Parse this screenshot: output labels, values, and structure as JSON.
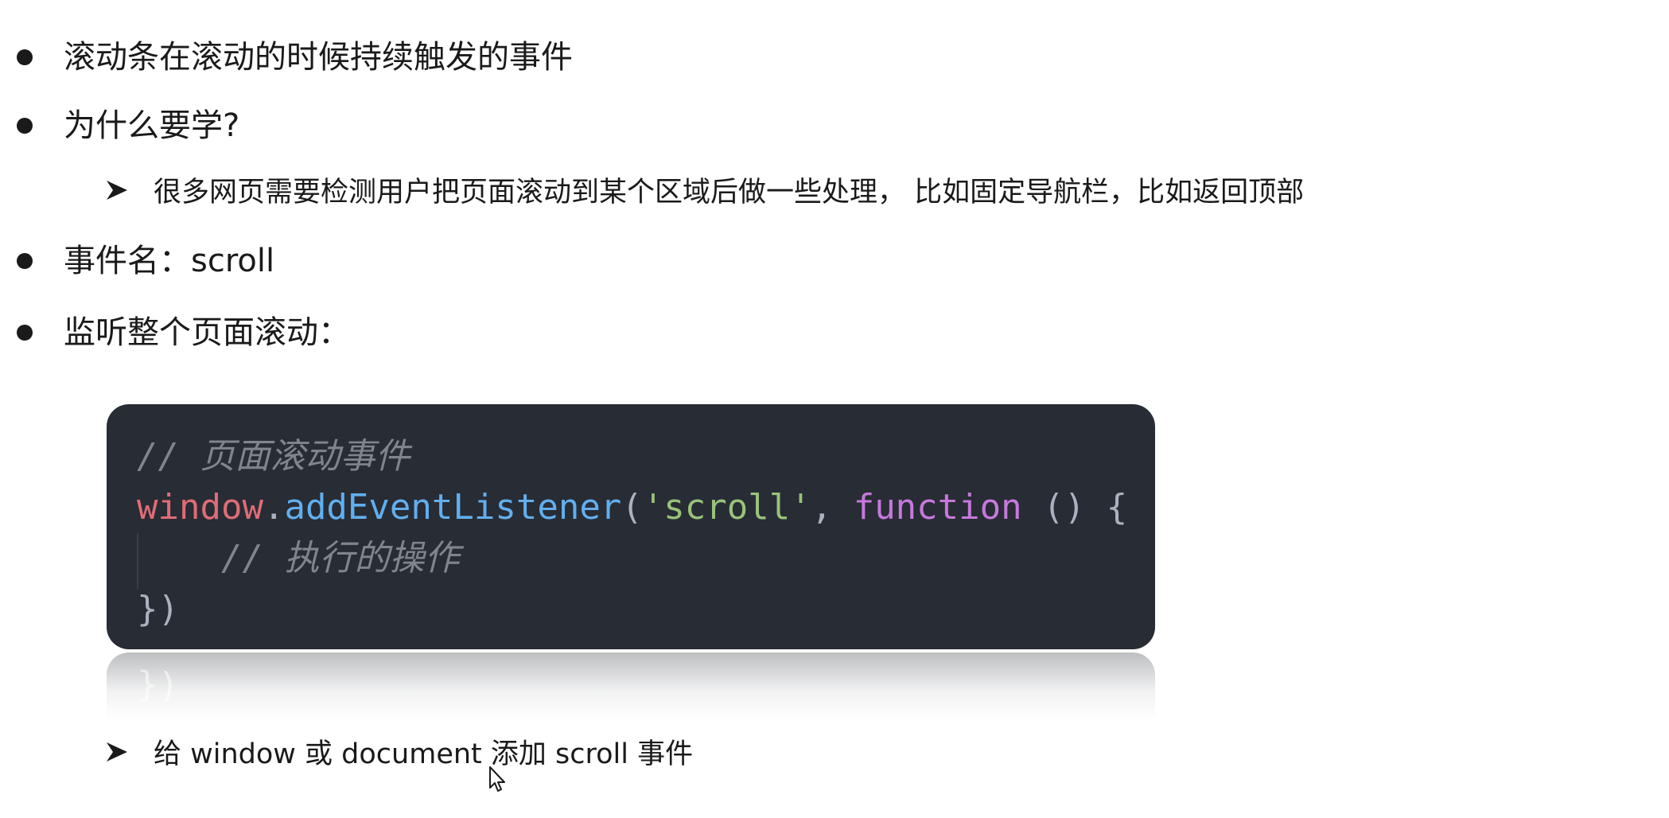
{
  "bullets": {
    "b1": "滚动条在滚动的时候持续触发的事件",
    "b2": "为什么要学?",
    "b2_sub": "很多网页需要检测用户把页面滚动到某个区域后做一些处理， 比如固定导航栏，比如返回顶部",
    "b3": "事件名：scroll",
    "b4": "监听整个页面滚动："
  },
  "code": {
    "line1_comment": "// 页面滚动事件",
    "line2_obj": "window",
    "line2_dot": ".",
    "line2_fn": "addEventListener",
    "line2_open": "(",
    "line2_str": "'scroll'",
    "line2_comma": ", ",
    "line2_kw": "function",
    "line2_tail": " () {",
    "line3_indent": "    ",
    "line3_comment": "// 执行的操作",
    "line4": "})",
    "reflection": "})"
  },
  "footer": {
    "sub": "给 window 或 document 添加 scroll 事件"
  },
  "icons": {
    "bullet": "filled-circle",
    "sub_bullet": "arrowhead-right",
    "cursor": "mouse-pointer"
  }
}
